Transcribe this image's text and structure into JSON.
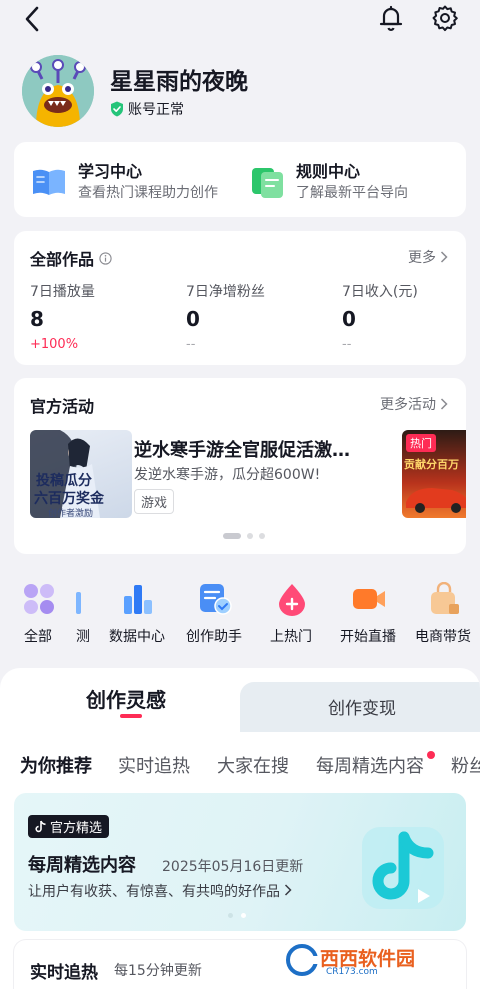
{
  "profile": {
    "name": "星星雨的夜晚",
    "status": "账号正常"
  },
  "centers": [
    {
      "title": "学习中心",
      "subtitle": "查看热门课程助力创作"
    },
    {
      "title": "规则中心",
      "subtitle": "了解最新平台导向"
    }
  ],
  "works": {
    "title": "全部作品",
    "more": "更多",
    "stats": [
      {
        "label": "7日播放量",
        "value": "8",
        "delta": "+100%"
      },
      {
        "label": "7日净增粉丝",
        "value": "0",
        "delta": "--"
      },
      {
        "label": "7日收入(元)",
        "value": "0",
        "delta": "--"
      }
    ]
  },
  "activity": {
    "title": "官方活动",
    "more": "更多活动",
    "item": {
      "title": "逆水寒手游全官服促活激…",
      "desc": "发逆水寒手游，瓜分超600W!",
      "tag": "游戏",
      "thumb_text1": "投稿瓜分",
      "thumb_text2": "六百万奖金",
      "thumb_text3": "创作者激励"
    },
    "next_tag": "热门",
    "next_text": "贡献分百万"
  },
  "tools": [
    {
      "label": "全部",
      "icon": "grid-icon"
    },
    {
      "label": "测",
      "icon": "partial-icon"
    },
    {
      "label": "数据中心",
      "icon": "bar-chart-icon"
    },
    {
      "label": "创作助手",
      "icon": "assistant-icon"
    },
    {
      "label": "上热门",
      "icon": "hot-drop-icon"
    },
    {
      "label": "开始直播",
      "icon": "live-camera-icon"
    },
    {
      "label": "电商带货",
      "icon": "shopping-bag-icon"
    }
  ],
  "inspire": {
    "tab_active": "创作灵感",
    "tab_inactive": "创作变现",
    "subtabs": [
      "为你推荐",
      "实时追热",
      "大家在搜",
      "每周精选内容",
      "粉丝"
    ],
    "weekly": {
      "badge": "官方精选",
      "title": "每周精选内容",
      "date": "2025年05月16日更新",
      "desc": "让用户有收获、有惊喜、有共鸣的好作品"
    },
    "realtime": {
      "title": "实时追热",
      "sub": "每15分钟更新"
    }
  },
  "watermark": {
    "brand": "西西软件园",
    "site": "CR173.com"
  }
}
